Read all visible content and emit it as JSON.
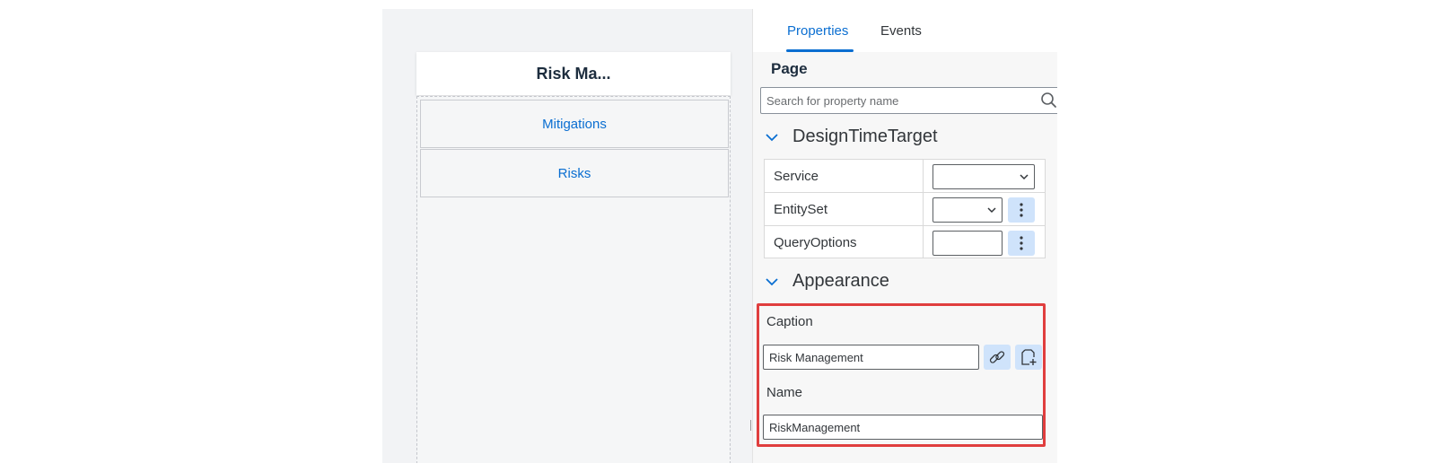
{
  "preview": {
    "title": "Risk Ma...",
    "items": [
      {
        "label": "Mitigations"
      },
      {
        "label": "Risks"
      }
    ]
  },
  "panel": {
    "tabs": [
      {
        "label": "Properties",
        "active": true
      },
      {
        "label": "Events",
        "active": false
      }
    ],
    "section_title": "Page",
    "search": {
      "placeholder": "Search for property name",
      "value": ""
    },
    "groups": {
      "design_time_target": {
        "title": "DesignTimeTarget",
        "rows": [
          {
            "label": "Service",
            "value": ""
          },
          {
            "label": "EntitySet",
            "value": ""
          },
          {
            "label": "QueryOptions",
            "value": ""
          }
        ]
      },
      "appearance": {
        "title": "Appearance",
        "caption": {
          "label": "Caption",
          "value": "Risk Management"
        },
        "name": {
          "label": "Name",
          "value": "RiskManagement"
        }
      }
    }
  },
  "colors": {
    "accent": "#0a6ed1",
    "highlight": "#e03e3e",
    "button_bg": "#cfe3fb"
  },
  "icons": [
    "search-icon",
    "chevron-down-icon",
    "more-vertical-icon",
    "link-icon",
    "add-file-icon"
  ]
}
